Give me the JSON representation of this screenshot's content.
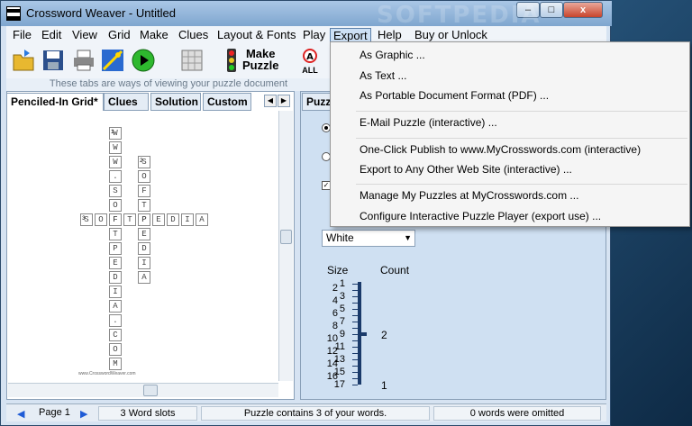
{
  "window": {
    "app_name": "Crossword Weaver",
    "doc_title": "Untitled",
    "title": "Crossword Weaver  -  Untitled"
  },
  "controls": {
    "minimize": "–",
    "maximize": "□",
    "close": "x"
  },
  "watermark": "SOFTPEDIA",
  "menu": [
    "File",
    "Edit",
    "View",
    "Grid",
    "Make",
    "Clues",
    "Layout & Fonts",
    "Play",
    "Export",
    "Help",
    "Buy or Unlock"
  ],
  "toolbar": {
    "make_puzzle_line1": "Make",
    "make_puzzle_line2": "Puzzle",
    "all_label": "ALL",
    "hint": "These tabs are ways of viewing your puzzle document"
  },
  "tabs": [
    "Penciled-In Grid*",
    "Clues",
    "Solution",
    "Custom"
  ],
  "right_tab": "Puzzle",
  "export_menu": {
    "groups": [
      [
        "As Graphic ...",
        "As Text ...",
        "As Portable Document Format (PDF) ..."
      ],
      [
        "E-Mail Puzzle (interactive) ..."
      ],
      [
        "One-Click Publish to www.MyCrosswords.com (interactive)",
        "Export to Any Other Web Site (interactive) ..."
      ],
      [
        "Manage My Puzzles at MyCrosswords.com ...",
        "Configure Interactive Puzzle Player (export use) ..."
      ]
    ]
  },
  "grid": {
    "word1": {
      "number": "1",
      "letters": [
        "W",
        "W",
        "W",
        ".",
        "S",
        "O",
        "F",
        "T",
        "P",
        "E",
        "D",
        "I",
        "A",
        ".",
        "C",
        "O",
        "M"
      ]
    },
    "word2": {
      "number": "2",
      "letters": [
        "S",
        "O",
        "F",
        "T",
        "P",
        "E",
        "D",
        "I",
        "A"
      ]
    },
    "word3": {
      "number": "3",
      "letters": [
        "S",
        "O",
        "F",
        "T",
        "P",
        "E",
        "D",
        "I",
        "A"
      ]
    },
    "footer": "www.CrosswordWeaver.com"
  },
  "settings": {
    "color_value": "White",
    "size_label": "Size",
    "count_label": "Count",
    "sizes": [
      "1",
      "2",
      "3",
      "4",
      "5",
      "6",
      "7",
      "8",
      "9",
      "10",
      "11",
      "12",
      "13",
      "14",
      "15",
      "16",
      "17"
    ],
    "count_at_9": "2",
    "count_at_17": "1",
    "thumb_size": 9
  },
  "status": {
    "page": "Page 1",
    "word_slots": "3 Word slots",
    "contains": "Puzzle contains 3 of your words.",
    "omitted": "0 words were omitted"
  }
}
